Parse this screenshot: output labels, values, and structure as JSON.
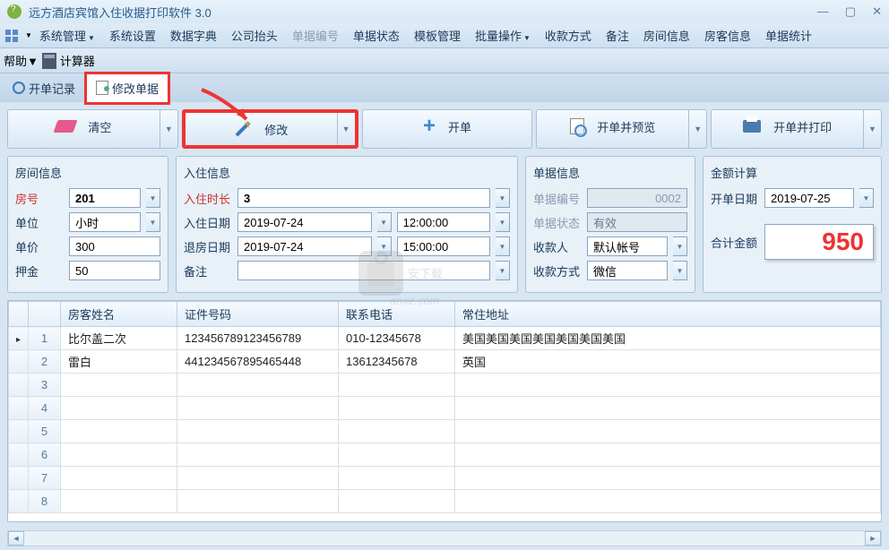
{
  "app": {
    "title": "远方酒店宾馆入住收据打印软件 3.0"
  },
  "menu": {
    "items": [
      "系统管理",
      "系统设置",
      "数据字典",
      "公司抬头",
      "单据编号",
      "单据状态",
      "模板管理",
      "批量操作",
      "收款方式",
      "备注",
      "房间信息",
      "房客信息",
      "单据统计"
    ],
    "disabled_index": 4,
    "help": "帮助",
    "calc": "计算器"
  },
  "tabs": {
    "record": "开单记录",
    "edit": "修改单据"
  },
  "actions": {
    "clear": "清空",
    "modify": "修改",
    "open": "开单",
    "preview": "开单并预览",
    "print": "开单并打印"
  },
  "room_panel": {
    "title": "房间信息",
    "room_no_label": "房号",
    "room_no": "201",
    "unit_label": "单位",
    "unit": "小时",
    "price_label": "单价",
    "price": "300",
    "deposit_label": "押金",
    "deposit": "50"
  },
  "checkin_panel": {
    "title": "入住信息",
    "duration_label": "入住时长",
    "duration": "3",
    "checkin_date_label": "入住日期",
    "checkin_date": "2019-07-24",
    "checkin_time": "12:00:00",
    "checkout_date_label": "退房日期",
    "checkout_date": "2019-07-24",
    "checkout_time": "15:00:00",
    "note_label": "备注",
    "note": ""
  },
  "bill_panel": {
    "title": "单据信息",
    "no_label": "单据编号",
    "no": "0002",
    "status_label": "单据状态",
    "status": "有效",
    "payee_label": "收款人",
    "payee": "默认帐号",
    "method_label": "收款方式",
    "method": "微信"
  },
  "amount_panel": {
    "title": "金额计算",
    "date_label": "开单日期",
    "date": "2019-07-25",
    "total_label": "合计金额",
    "total": "950"
  },
  "grid": {
    "headers": [
      "房客姓名",
      "证件号码",
      "联系电话",
      "常住地址"
    ],
    "rows": [
      {
        "n": "1",
        "name": "比尔盖二次",
        "id": "123456789123456789",
        "phone": "010-12345678",
        "addr": "美国美国美国美国美国美国美国"
      },
      {
        "n": "2",
        "name": "雷白",
        "id": "441234567895465448",
        "phone": "13612345678",
        "addr": "英国"
      },
      {
        "n": "3",
        "name": "",
        "id": "",
        "phone": "",
        "addr": ""
      },
      {
        "n": "4",
        "name": "",
        "id": "",
        "phone": "",
        "addr": ""
      },
      {
        "n": "5",
        "name": "",
        "id": "",
        "phone": "",
        "addr": ""
      },
      {
        "n": "6",
        "name": "",
        "id": "",
        "phone": "",
        "addr": ""
      },
      {
        "n": "7",
        "name": "",
        "id": "",
        "phone": "",
        "addr": ""
      },
      {
        "n": "8",
        "name": "",
        "id": "",
        "phone": "",
        "addr": ""
      }
    ]
  }
}
